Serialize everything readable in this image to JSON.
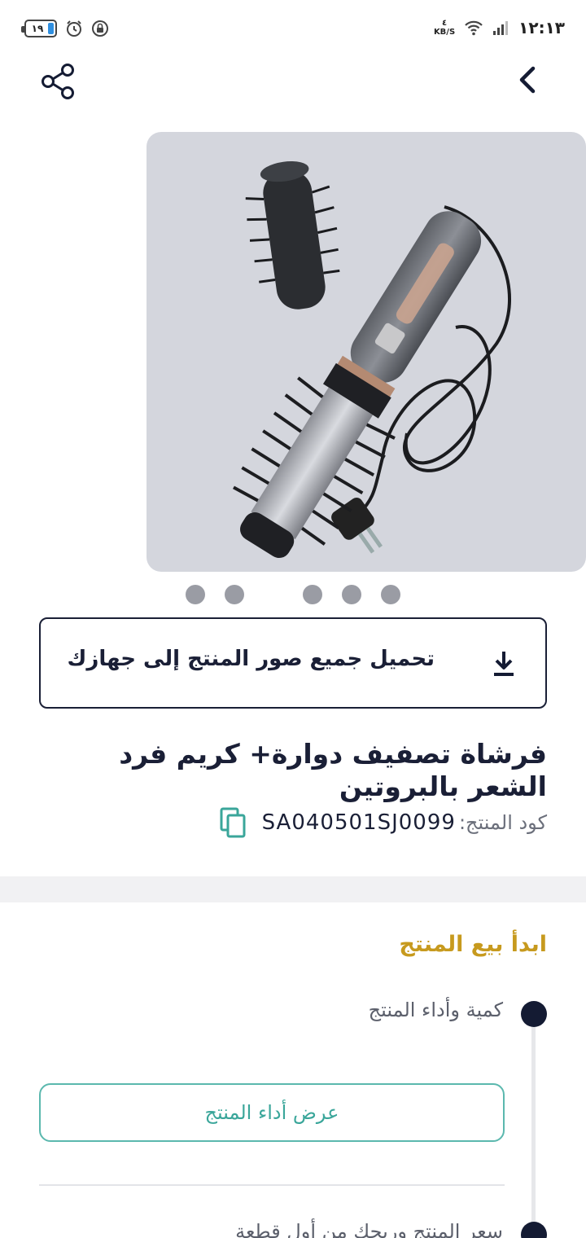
{
  "status_bar": {
    "time": "١٢:١٣",
    "battery": "١٩",
    "speed_value": "٤",
    "speed_unit": "KB/S"
  },
  "header": {
    "back_icon": "chevron-left-icon",
    "share_icon": "share-icon"
  },
  "gallery": {
    "image_alt": "hair-dryer-brush-product-photo",
    "dot_count": 5
  },
  "download": {
    "label": "تحميل جميع صور المنتج إلى جهازك",
    "icon": "download-icon"
  },
  "product": {
    "title": "فرشاة تصفيف دوارة+ كريم فرد الشعر بالبروتين",
    "code_label": "كود المنتج:",
    "code_value": "SA040501SJ0099",
    "copy_icon": "copy-icon"
  },
  "sell": {
    "heading": "ابدأ بيع المنتج",
    "steps": [
      {
        "label": "كمية وأداء المنتج"
      },
      {
        "label": "سعر المنتج وربحك من أول قطعة"
      }
    ],
    "performance_button": "عرض أداء المنتج"
  },
  "colors": {
    "primary": "#1a1f36",
    "accent_gold": "#c79a1e",
    "accent_teal": "#3aa69a"
  }
}
